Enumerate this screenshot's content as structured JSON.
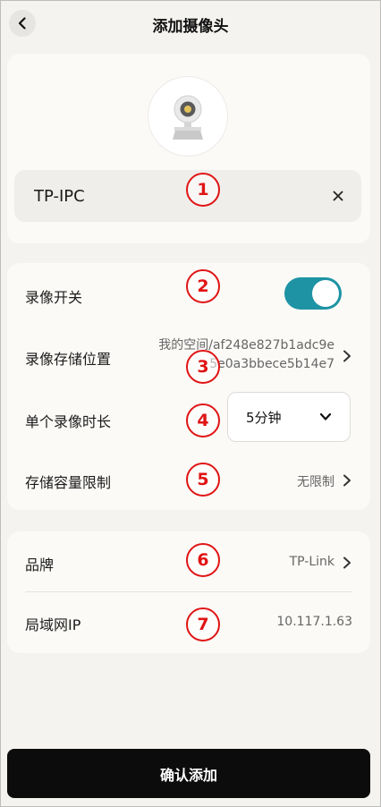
{
  "header": {
    "title": "添加摄像头"
  },
  "camera": {
    "name_value": "TP-IPC"
  },
  "recording": {
    "switch_label": "录像开关",
    "switch_on": true,
    "storage_label": "录像存储位置",
    "storage_value_line1": "我的空间/af248e827b1adc9e",
    "storage_value_line2": "5e0a3bbece5b14e7",
    "duration_label": "单个录像时长",
    "duration_value": "5分钟",
    "capacity_label": "存储容量限制",
    "capacity_value": "无限制"
  },
  "device": {
    "brand_label": "品牌",
    "brand_value": "TP-Link",
    "ip_label": "局域网IP",
    "ip_value": "10.117.1.63"
  },
  "markers": [
    "1",
    "2",
    "3",
    "4",
    "5",
    "6",
    "7"
  ],
  "footer": {
    "confirm_label": "确认添加"
  },
  "colors": {
    "accent": "#1d93a4",
    "marker": "#e01414",
    "button": "#0c0c0c"
  },
  "icons": [
    "back-icon",
    "camera-icon",
    "clear-icon",
    "chevron-right-icon",
    "chevron-down-icon"
  ]
}
